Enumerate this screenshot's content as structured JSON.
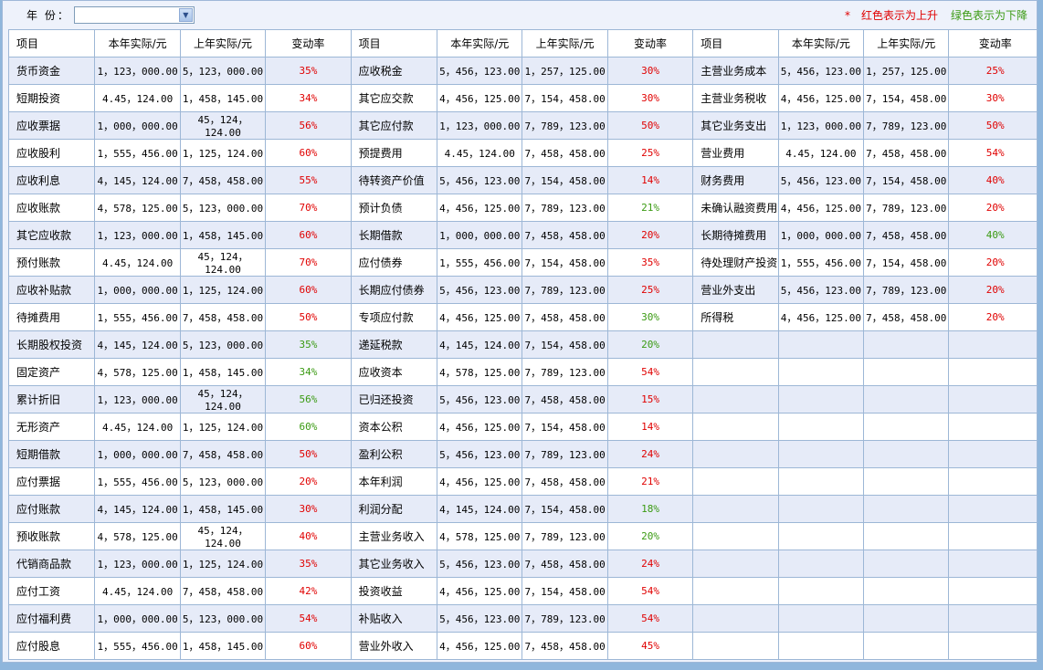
{
  "filter": {
    "year_label": "年  份：",
    "year_value": ""
  },
  "legend": {
    "star": "*",
    "red_text": "红色表示为上升",
    "green_text": "绿色表示为下降"
  },
  "colors": {
    "up": "#e00000",
    "down": "#3a9a12",
    "header_bg": "#ffffff",
    "row_alt_bg": "#e6ebf8",
    "border": "#9db7d6"
  },
  "headers": [
    "项目",
    "本年实际/元",
    "上年实际/元",
    "变动率",
    "项目",
    "本年实际/元",
    "上年实际/元",
    "变动率",
    "项目",
    "本年实际/元",
    "上年实际/元",
    "变动率"
  ],
  "rows": [
    [
      {
        "item": "货币资金",
        "cur": "1，123，000.00",
        "prev": "5，123，000.00",
        "rate": "35%",
        "dir": "up"
      },
      {
        "item": "应收税金",
        "cur": "5，456，123.00",
        "prev": "1，257，125.00",
        "rate": "30%",
        "dir": "up"
      },
      {
        "item": "主营业务成本",
        "cur": "5，456，123.00",
        "prev": "1，257，125.00",
        "rate": "25%",
        "dir": "up"
      }
    ],
    [
      {
        "item": "短期投资",
        "cur": "4.45，124.00",
        "prev": "1，458，145.00",
        "rate": "34%",
        "dir": "up"
      },
      {
        "item": "其它应交款",
        "cur": "4，456，125.00",
        "prev": "7，154，458.00",
        "rate": "30%",
        "dir": "up"
      },
      {
        "item": "主营业务税收",
        "cur": "4，456，125.00",
        "prev": "7，154，458.00",
        "rate": "30%",
        "dir": "up"
      }
    ],
    [
      {
        "item": "应收票据",
        "cur": "1，000，000.00",
        "prev": "45，124，124.00",
        "rate": "56%",
        "dir": "up"
      },
      {
        "item": "其它应付款",
        "cur": "1，123，000.00",
        "prev": "7，789，123.00",
        "rate": "50%",
        "dir": "up"
      },
      {
        "item": "其它业务支出",
        "cur": "1，123，000.00",
        "prev": "7，789，123.00",
        "rate": "50%",
        "dir": "up"
      }
    ],
    [
      {
        "item": "应收股利",
        "cur": "1，555，456.00",
        "prev": "1，125，124.00",
        "rate": "60%",
        "dir": "up"
      },
      {
        "item": "预提费用",
        "cur": "4.45，124.00",
        "prev": "7，458，458.00",
        "rate": "25%",
        "dir": "up"
      },
      {
        "item": "营业费用",
        "cur": "4.45，124.00",
        "prev": "7，458，458.00",
        "rate": "54%",
        "dir": "up"
      }
    ],
    [
      {
        "item": "应收利息",
        "cur": "4，145，124.00",
        "prev": "7，458，458.00",
        "rate": "55%",
        "dir": "up"
      },
      {
        "item": "待转资产价值",
        "cur": "5，456，123.00",
        "prev": "7，154，458.00",
        "rate": "14%",
        "dir": "up"
      },
      {
        "item": "财务费用",
        "cur": "5，456，123.00",
        "prev": "7，154，458.00",
        "rate": "40%",
        "dir": "up"
      }
    ],
    [
      {
        "item": "应收账款",
        "cur": "4，578，125.00",
        "prev": "5，123，000.00",
        "rate": "70%",
        "dir": "up"
      },
      {
        "item": "预计负债",
        "cur": "4，456，125.00",
        "prev": "7，789，123.00",
        "rate": "21%",
        "dir": "down"
      },
      {
        "item": "未确认融资费用",
        "cur": "4，456，125.00",
        "prev": "7，789，123.00",
        "rate": "20%",
        "dir": "up"
      }
    ],
    [
      {
        "item": "其它应收款",
        "cur": "1，123，000.00",
        "prev": "1，458，145.00",
        "rate": "60%",
        "dir": "up"
      },
      {
        "item": "长期借款",
        "cur": "1，000，000.00",
        "prev": "7，458，458.00",
        "rate": "20%",
        "dir": "up"
      },
      {
        "item": "长期待摊费用",
        "cur": "1，000，000.00",
        "prev": "7，458，458.00",
        "rate": "40%",
        "dir": "down"
      }
    ],
    [
      {
        "item": "预付账款",
        "cur": "4.45，124.00",
        "prev": "45，124，124.00",
        "rate": "70%",
        "dir": "up"
      },
      {
        "item": "应付债券",
        "cur": "1，555，456.00",
        "prev": "7，154，458.00",
        "rate": "35%",
        "dir": "up"
      },
      {
        "item": "待处理财产投资",
        "cur": "1，555，456.00",
        "prev": "7，154，458.00",
        "rate": "20%",
        "dir": "up"
      }
    ],
    [
      {
        "item": "应收补贴款",
        "cur": "1，000，000.00",
        "prev": "1，125，124.00",
        "rate": "60%",
        "dir": "up"
      },
      {
        "item": "长期应付债券",
        "cur": "5，456，123.00",
        "prev": "7，789，123.00",
        "rate": "25%",
        "dir": "up"
      },
      {
        "item": "营业外支出",
        "cur": "5，456，123.00",
        "prev": "7，789，123.00",
        "rate": "20%",
        "dir": "up"
      }
    ],
    [
      {
        "item": "待摊费用",
        "cur": "1，555，456.00",
        "prev": "7，458，458.00",
        "rate": "50%",
        "dir": "up"
      },
      {
        "item": "专项应付款",
        "cur": "4，456，125.00",
        "prev": "7，458，458.00",
        "rate": "30%",
        "dir": "down"
      },
      {
        "item": "所得税",
        "cur": "4，456，125.00",
        "prev": "7，458，458.00",
        "rate": "20%",
        "dir": "up"
      }
    ],
    [
      {
        "item": "长期股权投资",
        "cur": "4，145，124.00",
        "prev": "5，123，000.00",
        "rate": "35%",
        "dir": "down"
      },
      {
        "item": "递延税款",
        "cur": "4，145，124.00",
        "prev": "7，154，458.00",
        "rate": "20%",
        "dir": "down"
      },
      null
    ],
    [
      {
        "item": "固定资产",
        "cur": "4，578，125.00",
        "prev": "1，458，145.00",
        "rate": "34%",
        "dir": "down"
      },
      {
        "item": "应收资本",
        "cur": "4，578，125.00",
        "prev": "7，789，123.00",
        "rate": "54%",
        "dir": "up"
      },
      null
    ],
    [
      {
        "item": "累计折旧",
        "cur": "1，123，000.00",
        "prev": "45，124，124.00",
        "rate": "56%",
        "dir": "down"
      },
      {
        "item": "已归还投资",
        "cur": "5，456，123.00",
        "prev": "7，458，458.00",
        "rate": "15%",
        "dir": "up"
      },
      null
    ],
    [
      {
        "item": "无形资产",
        "cur": "4.45，124.00",
        "prev": "1，125，124.00",
        "rate": "60%",
        "dir": "down"
      },
      {
        "item": "资本公积",
        "cur": "4，456，125.00",
        "prev": "7，154，458.00",
        "rate": "14%",
        "dir": "up"
      },
      null
    ],
    [
      {
        "item": "短期借款",
        "cur": "1，000，000.00",
        "prev": "7，458，458.00",
        "rate": "50%",
        "dir": "up"
      },
      {
        "item": "盈利公积",
        "cur": "5，456，123.00",
        "prev": "7，789，123.00",
        "rate": "24%",
        "dir": "up"
      },
      null
    ],
    [
      {
        "item": "应付票据",
        "cur": "1，555，456.00",
        "prev": "5，123，000.00",
        "rate": "20%",
        "dir": "up"
      },
      {
        "item": "本年利润",
        "cur": "4，456，125.00",
        "prev": "7，458，458.00",
        "rate": "21%",
        "dir": "up"
      },
      null
    ],
    [
      {
        "item": "应付账款",
        "cur": "4，145，124.00",
        "prev": "1，458，145.00",
        "rate": "30%",
        "dir": "up"
      },
      {
        "item": "利润分配",
        "cur": "4，145，124.00",
        "prev": "7，154，458.00",
        "rate": "18%",
        "dir": "down"
      },
      null
    ],
    [
      {
        "item": "预收账款",
        "cur": "4，578，125.00",
        "prev": "45，124，124.00",
        "rate": "40%",
        "dir": "up"
      },
      {
        "item": "主营业务收入",
        "cur": "4，578，125.00",
        "prev": "7，789，123.00",
        "rate": "20%",
        "dir": "down"
      },
      null
    ],
    [
      {
        "item": "代销商品款",
        "cur": "1，123，000.00",
        "prev": "1，125，124.00",
        "rate": "35%",
        "dir": "up"
      },
      {
        "item": "其它业务收入",
        "cur": "5，456，123.00",
        "prev": "7，458，458.00",
        "rate": "24%",
        "dir": "up"
      },
      null
    ],
    [
      {
        "item": "应付工资",
        "cur": "4.45，124.00",
        "prev": "7，458，458.00",
        "rate": "42%",
        "dir": "up"
      },
      {
        "item": "投资收益",
        "cur": "4，456，125.00",
        "prev": "7，154，458.00",
        "rate": "54%",
        "dir": "up"
      },
      null
    ],
    [
      {
        "item": "应付福利费",
        "cur": "1，000，000.00",
        "prev": "5，123，000.00",
        "rate": "54%",
        "dir": "up"
      },
      {
        "item": "补贴收入",
        "cur": "5，456，123.00",
        "prev": "7，789，123.00",
        "rate": "54%",
        "dir": "up"
      },
      null
    ],
    [
      {
        "item": "应付股息",
        "cur": "1，555，456.00",
        "prev": "1，458，145.00",
        "rate": "60%",
        "dir": "up"
      },
      {
        "item": "营业外收入",
        "cur": "4，456，125.00",
        "prev": "7，458，458.00",
        "rate": "45%",
        "dir": "up"
      },
      null
    ]
  ]
}
